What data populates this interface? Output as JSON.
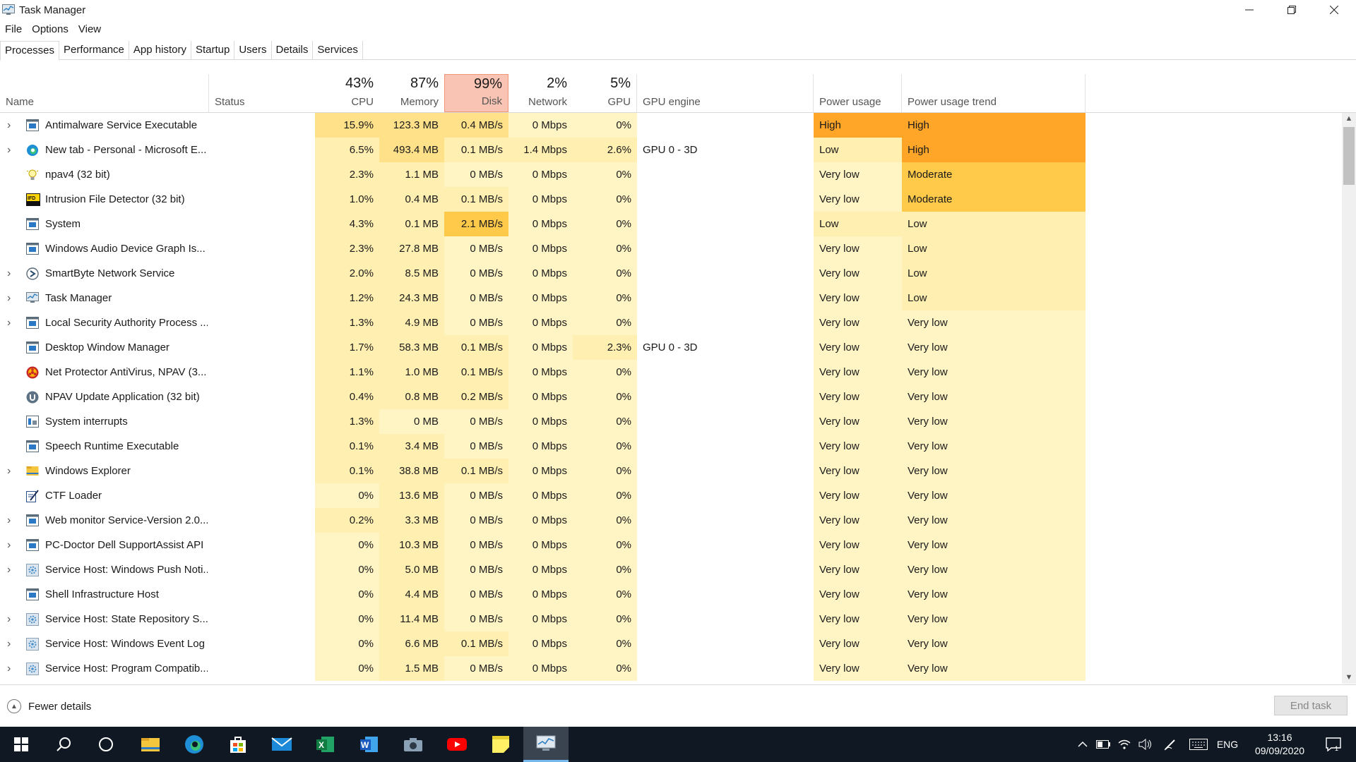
{
  "window": {
    "title": "Task Manager"
  },
  "menu": [
    "File",
    "Options",
    "View"
  ],
  "tabs": [
    "Processes",
    "Performance",
    "App history",
    "Startup",
    "Users",
    "Details",
    "Services"
  ],
  "columns": {
    "name": "Name",
    "status": "Status",
    "cpu": {
      "pct": "43%",
      "label": "CPU"
    },
    "memory": {
      "pct": "87%",
      "label": "Memory"
    },
    "disk": {
      "pct": "99%",
      "label": "Disk"
    },
    "network": {
      "pct": "2%",
      "label": "Network"
    },
    "gpu": {
      "pct": "5%",
      "label": "GPU"
    },
    "gpu_engine": "GPU engine",
    "power": "Power usage",
    "power_trend": "Power usage trend"
  },
  "colors": {
    "heat1": "#fff4c4",
    "heat2": "#ffefb1",
    "heat3": "#ffe18a",
    "heat4": "#ffc94a",
    "heat5": "#ffa528"
  },
  "processes": [
    {
      "name": "Antimalware Service Executable",
      "expand": true,
      "icon": "blue-window-icon",
      "cpu": "15.9%",
      "memory": "123.3 MB",
      "disk": "0.4 MB/s",
      "network": "0 Mbps",
      "gpu": "0%",
      "gpu_engine": "",
      "power": "High",
      "trend": "High",
      "h": [
        3,
        3,
        3,
        1,
        1,
        0,
        5,
        5
      ]
    },
    {
      "name": "New tab - Personal - Microsoft E...",
      "expand": true,
      "icon": "edge-icon",
      "cpu": "6.5%",
      "memory": "493.4 MB",
      "disk": "0.1 MB/s",
      "network": "1.4 Mbps",
      "gpu": "2.6%",
      "gpu_engine": "GPU 0 - 3D",
      "power": "Low",
      "trend": "High",
      "h": [
        2,
        3,
        2,
        2,
        2,
        0,
        2,
        5
      ]
    },
    {
      "name": "npav4 (32 bit)",
      "expand": false,
      "icon": "bulb-icon",
      "cpu": "2.3%",
      "memory": "1.1 MB",
      "disk": "0 MB/s",
      "network": "0 Mbps",
      "gpu": "0%",
      "gpu_engine": "",
      "power": "Very low",
      "trend": "Moderate",
      "h": [
        2,
        2,
        1,
        1,
        1,
        0,
        1,
        4
      ]
    },
    {
      "name": "Intrusion File Detector (32 bit)",
      "expand": false,
      "icon": "ifd-icon",
      "cpu": "1.0%",
      "memory": "0.4 MB",
      "disk": "0.1 MB/s",
      "network": "0 Mbps",
      "gpu": "0%",
      "gpu_engine": "",
      "power": "Very low",
      "trend": "Moderate",
      "h": [
        2,
        2,
        2,
        1,
        1,
        0,
        1,
        4
      ]
    },
    {
      "name": "System",
      "expand": false,
      "icon": "blue-window-icon",
      "cpu": "4.3%",
      "memory": "0.1 MB",
      "disk": "2.1 MB/s",
      "network": "0 Mbps",
      "gpu": "0%",
      "gpu_engine": "",
      "power": "Low",
      "trend": "Low",
      "h": [
        2,
        2,
        4,
        1,
        1,
        0,
        2,
        2
      ]
    },
    {
      "name": "Windows Audio Device Graph Is...",
      "expand": false,
      "icon": "blue-window-icon",
      "cpu": "2.3%",
      "memory": "27.8 MB",
      "disk": "0 MB/s",
      "network": "0 Mbps",
      "gpu": "0%",
      "gpu_engine": "",
      "power": "Very low",
      "trend": "Low",
      "h": [
        2,
        2,
        1,
        1,
        1,
        0,
        1,
        2
      ]
    },
    {
      "name": "SmartByte Network Service",
      "expand": true,
      "icon": "smartbyte-icon",
      "cpu": "2.0%",
      "memory": "8.5 MB",
      "disk": "0 MB/s",
      "network": "0 Mbps",
      "gpu": "0%",
      "gpu_engine": "",
      "power": "Very low",
      "trend": "Low",
      "h": [
        2,
        2,
        1,
        1,
        1,
        0,
        1,
        2
      ]
    },
    {
      "name": "Task Manager",
      "expand": true,
      "icon": "task-manager-icon",
      "cpu": "1.2%",
      "memory": "24.3 MB",
      "disk": "0 MB/s",
      "network": "0 Mbps",
      "gpu": "0%",
      "gpu_engine": "",
      "power": "Very low",
      "trend": "Low",
      "h": [
        2,
        2,
        1,
        1,
        1,
        0,
        1,
        2
      ]
    },
    {
      "name": "Local Security Authority Process ...",
      "expand": true,
      "icon": "blue-window-icon",
      "cpu": "1.3%",
      "memory": "4.9 MB",
      "disk": "0 MB/s",
      "network": "0 Mbps",
      "gpu": "0%",
      "gpu_engine": "",
      "power": "Very low",
      "trend": "Very low",
      "h": [
        2,
        2,
        1,
        1,
        1,
        0,
        1,
        1
      ]
    },
    {
      "name": "Desktop Window Manager",
      "expand": false,
      "icon": "blue-window-icon",
      "cpu": "1.7%",
      "memory": "58.3 MB",
      "disk": "0.1 MB/s",
      "network": "0 Mbps",
      "gpu": "2.3%",
      "gpu_engine": "GPU 0 - 3D",
      "power": "Very low",
      "trend": "Very low",
      "h": [
        2,
        2,
        2,
        1,
        2,
        0,
        1,
        1
      ]
    },
    {
      "name": "Net Protector AntiVirus, NPAV (3...",
      "expand": false,
      "icon": "biohazard-icon",
      "cpu": "1.1%",
      "memory": "1.0 MB",
      "disk": "0.1 MB/s",
      "network": "0 Mbps",
      "gpu": "0%",
      "gpu_engine": "",
      "power": "Very low",
      "trend": "Very low",
      "h": [
        2,
        2,
        2,
        1,
        1,
        0,
        1,
        1
      ]
    },
    {
      "name": "NPAV Update Application (32 bit)",
      "expand": false,
      "icon": "npav-update-icon",
      "cpu": "0.4%",
      "memory": "0.8 MB",
      "disk": "0.2 MB/s",
      "network": "0 Mbps",
      "gpu": "0%",
      "gpu_engine": "",
      "power": "Very low",
      "trend": "Very low",
      "h": [
        2,
        2,
        2,
        1,
        1,
        0,
        1,
        1
      ]
    },
    {
      "name": "System interrupts",
      "expand": false,
      "icon": "interrupts-icon",
      "cpu": "1.3%",
      "memory": "0 MB",
      "disk": "0 MB/s",
      "network": "0 Mbps",
      "gpu": "0%",
      "gpu_engine": "",
      "power": "Very low",
      "trend": "Very low",
      "h": [
        2,
        1,
        1,
        1,
        1,
        0,
        1,
        1
      ]
    },
    {
      "name": "Speech Runtime Executable",
      "expand": false,
      "icon": "blue-window-icon",
      "cpu": "0.1%",
      "memory": "3.4 MB",
      "disk": "0 MB/s",
      "network": "0 Mbps",
      "gpu": "0%",
      "gpu_engine": "",
      "power": "Very low",
      "trend": "Very low",
      "h": [
        2,
        2,
        1,
        1,
        1,
        0,
        1,
        1
      ]
    },
    {
      "name": "Windows Explorer",
      "expand": true,
      "icon": "folder-icon",
      "cpu": "0.1%",
      "memory": "38.8 MB",
      "disk": "0.1 MB/s",
      "network": "0 Mbps",
      "gpu": "0%",
      "gpu_engine": "",
      "power": "Very low",
      "trend": "Very low",
      "h": [
        2,
        2,
        2,
        1,
        1,
        0,
        1,
        1
      ]
    },
    {
      "name": "CTF Loader",
      "expand": false,
      "icon": "ctf-loader-icon",
      "cpu": "0%",
      "memory": "13.6 MB",
      "disk": "0 MB/s",
      "network": "0 Mbps",
      "gpu": "0%",
      "gpu_engine": "",
      "power": "Very low",
      "trend": "Very low",
      "h": [
        1,
        2,
        1,
        1,
        1,
        0,
        1,
        1
      ]
    },
    {
      "name": "Web monitor Service-Version 2.0...",
      "expand": true,
      "icon": "blue-window-icon",
      "cpu": "0.2%",
      "memory": "3.3 MB",
      "disk": "0 MB/s",
      "network": "0 Mbps",
      "gpu": "0%",
      "gpu_engine": "",
      "power": "Very low",
      "trend": "Very low",
      "h": [
        2,
        2,
        1,
        1,
        1,
        0,
        1,
        1
      ]
    },
    {
      "name": "PC-Doctor Dell SupportAssist API",
      "expand": true,
      "icon": "blue-window-icon",
      "cpu": "0%",
      "memory": "10.3 MB",
      "disk": "0 MB/s",
      "network": "0 Mbps",
      "gpu": "0%",
      "gpu_engine": "",
      "power": "Very low",
      "trend": "Very low",
      "h": [
        1,
        2,
        1,
        1,
        1,
        0,
        1,
        1
      ]
    },
    {
      "name": "Service Host: Windows Push Noti...",
      "expand": true,
      "icon": "gear-icon",
      "cpu": "0%",
      "memory": "5.0 MB",
      "disk": "0 MB/s",
      "network": "0 Mbps",
      "gpu": "0%",
      "gpu_engine": "",
      "power": "Very low",
      "trend": "Very low",
      "h": [
        1,
        2,
        1,
        1,
        1,
        0,
        1,
        1
      ]
    },
    {
      "name": "Shell Infrastructure Host",
      "expand": false,
      "icon": "blue-window-icon",
      "cpu": "0%",
      "memory": "4.4 MB",
      "disk": "0 MB/s",
      "network": "0 Mbps",
      "gpu": "0%",
      "gpu_engine": "",
      "power": "Very low",
      "trend": "Very low",
      "h": [
        1,
        2,
        1,
        1,
        1,
        0,
        1,
        1
      ]
    },
    {
      "name": "Service Host: State Repository S...",
      "expand": true,
      "icon": "gear-icon",
      "cpu": "0%",
      "memory": "11.4 MB",
      "disk": "0 MB/s",
      "network": "0 Mbps",
      "gpu": "0%",
      "gpu_engine": "",
      "power": "Very low",
      "trend": "Very low",
      "h": [
        1,
        2,
        1,
        1,
        1,
        0,
        1,
        1
      ]
    },
    {
      "name": "Service Host: Windows Event Log",
      "expand": true,
      "icon": "gear-icon",
      "cpu": "0%",
      "memory": "6.6 MB",
      "disk": "0.1 MB/s",
      "network": "0 Mbps",
      "gpu": "0%",
      "gpu_engine": "",
      "power": "Very low",
      "trend": "Very low",
      "h": [
        1,
        2,
        2,
        1,
        1,
        0,
        1,
        1
      ]
    },
    {
      "name": "Service Host: Program Compatib...",
      "expand": true,
      "icon": "gear-icon",
      "cpu": "0%",
      "memory": "1.5 MB",
      "disk": "0 MB/s",
      "network": "0 Mbps",
      "gpu": "0%",
      "gpu_engine": "",
      "power": "Very low",
      "trend": "Very low",
      "h": [
        1,
        2,
        1,
        1,
        1,
        0,
        1,
        1
      ]
    }
  ],
  "footer": {
    "fewer_details": "Fewer details",
    "end_task": "End task"
  },
  "taskbar": {
    "apps": [
      "windows-start-icon",
      "search-icon",
      "task-view-icon",
      "file-explorer-icon",
      "edge-icon",
      "store-icon",
      "mail-icon",
      "excel-icon",
      "word-icon",
      "camera-icon",
      "youtube-icon",
      "sticky-notes-icon",
      "task-manager-icon"
    ],
    "lang": "ENG",
    "time": "13:16",
    "date": "09/09/2020"
  }
}
